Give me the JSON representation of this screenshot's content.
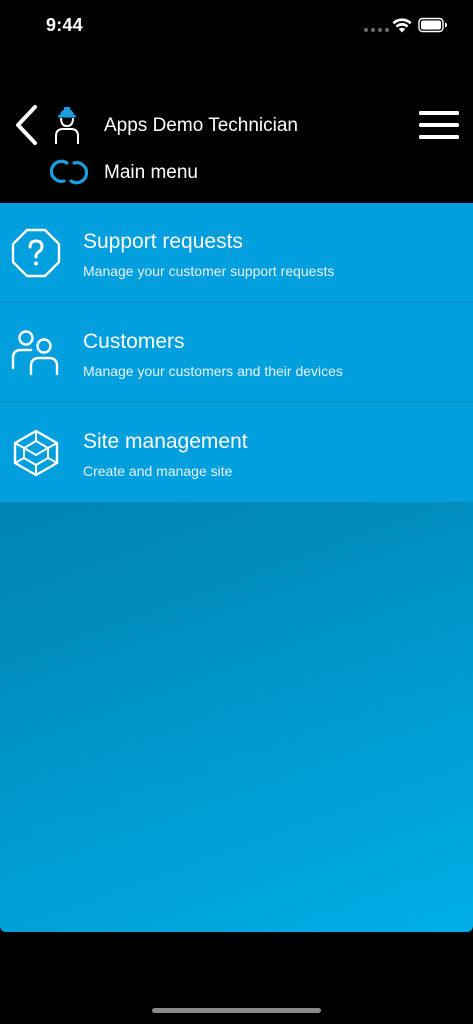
{
  "status_bar": {
    "time": "9:44"
  },
  "header": {
    "title": "Apps Demo Technician",
    "subtitle": "Main menu",
    "icons": {
      "back": "chevron-left-icon",
      "technician": "technician-helmet-icon",
      "link": "link-chain-icon",
      "menu": "hamburger-menu-icon"
    }
  },
  "menu": {
    "items": [
      {
        "title": "Support requests",
        "description": "Manage your customer support requests",
        "icon": "question-octagon-icon"
      },
      {
        "title": "Customers",
        "description": "Manage your customers and their devices",
        "icon": "users-icon"
      },
      {
        "title": "Site management",
        "description": "Create and manage site",
        "icon": "cube-outline-icon"
      }
    ]
  },
  "colors": {
    "background": "#000000",
    "menu_item": "#029fdf",
    "content_gradient_start": "#007aa6",
    "content_gradient_end": "#00aee8",
    "accent_icon": "#1aa0e0"
  }
}
